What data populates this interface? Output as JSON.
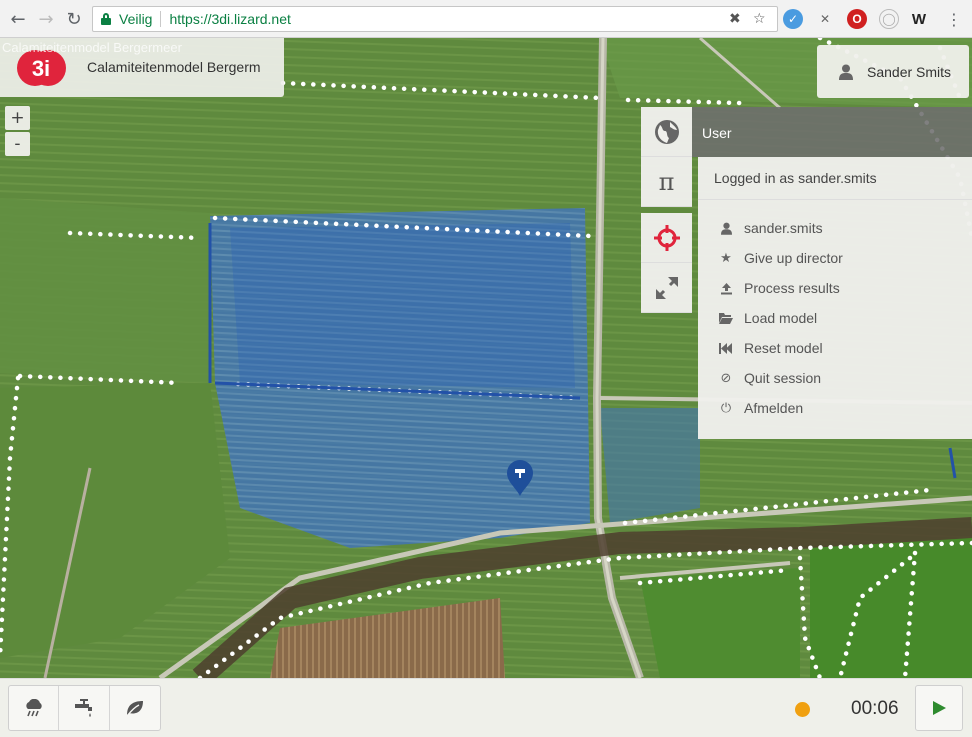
{
  "browser": {
    "secure_label": "Veilig",
    "url": "https://3di.lizard.net",
    "extensions": [
      {
        "name": "extension-blue-icon",
        "color": "#4a9be0"
      },
      {
        "name": "extension-pin-icon",
        "color": "#888888"
      },
      {
        "name": "opera-icon",
        "color": "#d02020"
      },
      {
        "name": "extension-globe-icon",
        "color": "#bbbbbb"
      },
      {
        "name": "extension-w-icon",
        "color": "#222222"
      }
    ]
  },
  "header": {
    "logo_text": "3i",
    "model_name": "Calamiteitenmodel Bergerm",
    "model_name_ghost": "Calamiteitenmodel Bergermeer"
  },
  "zoom": {
    "in": "+",
    "out": "-"
  },
  "user_button": {
    "name": "Sander Smits"
  },
  "tools": {
    "pi_label": "π",
    "icons": [
      "globe-icon",
      "pi-icon",
      "crosshair-icon",
      "expand-icon"
    ]
  },
  "user_panel": {
    "title": "User",
    "logged_in": "Logged in as sander.smits",
    "items": [
      {
        "label": "sander.smits",
        "icon": "user-icon"
      },
      {
        "label": "Give up director",
        "icon": "star-icon"
      },
      {
        "label": "Process results",
        "icon": "upload-icon"
      },
      {
        "label": "Load model",
        "icon": "folder-icon"
      },
      {
        "label": "Reset model",
        "icon": "rewind-icon"
      },
      {
        "label": "Quit session",
        "icon": "ban-icon"
      },
      {
        "label": "Afmelden",
        "icon": "power-icon"
      }
    ]
  },
  "bottom_bar": {
    "tools": [
      "rain-icon",
      "tap-icon",
      "leaf-icon"
    ],
    "timer": "00:06",
    "status_color": "#f0a010",
    "play_color": "#2e8b2e"
  },
  "colors": {
    "brand": "#e0243c",
    "flood": "#2f63b8",
    "panel_header": "#6e6e6e"
  }
}
